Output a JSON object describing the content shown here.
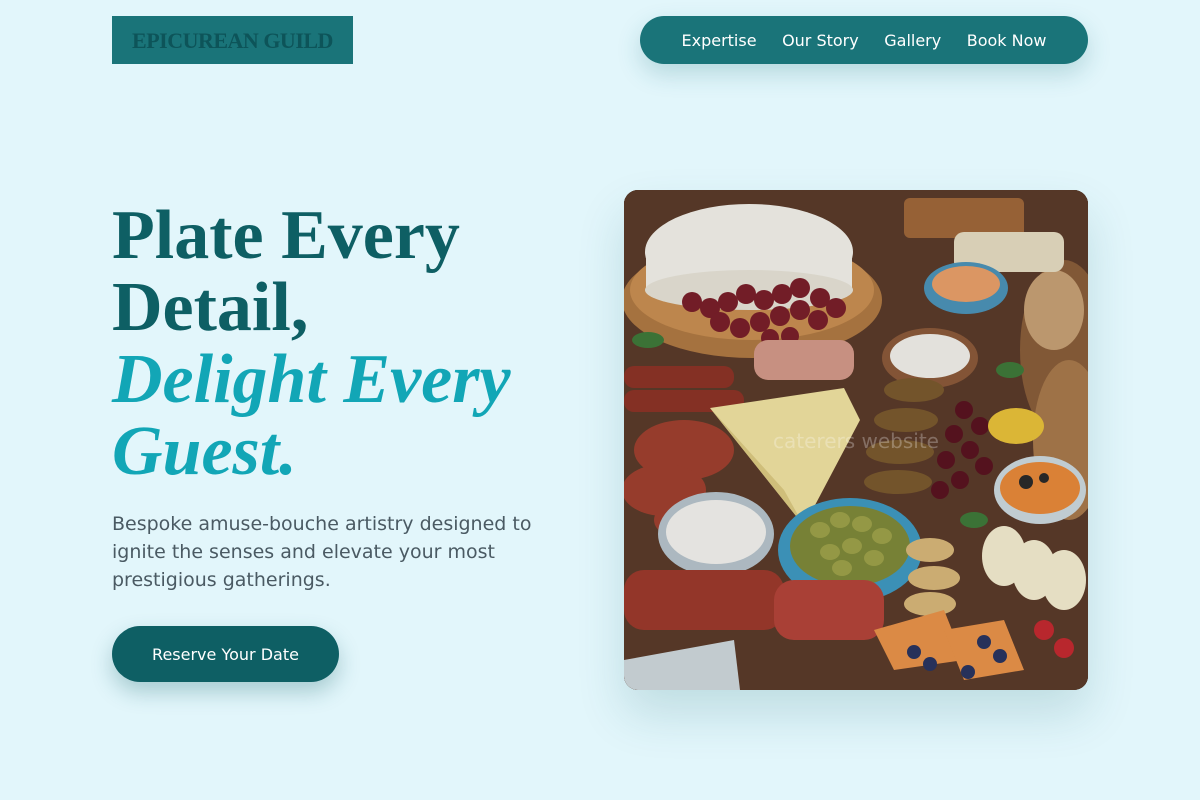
{
  "header": {
    "logo": "EPICUREAN GUILD",
    "nav": [
      "Expertise",
      "Our Story",
      "Gallery",
      "Book Now"
    ]
  },
  "hero": {
    "headline_line1": "Plate Every Detail,",
    "headline_line2": "Delight Every Guest.",
    "subtitle": "Bespoke amuse-bouche artistry designed to ignite the senses and elevate your most prestigious gatherings.",
    "cta_label": "Reserve Your Date",
    "image_watermark": "caterers website"
  },
  "colors": {
    "background": "#e2f6fb",
    "primary": "#1a7479",
    "primary_dark": "#0e5f64",
    "accent": "#12a6b6"
  }
}
